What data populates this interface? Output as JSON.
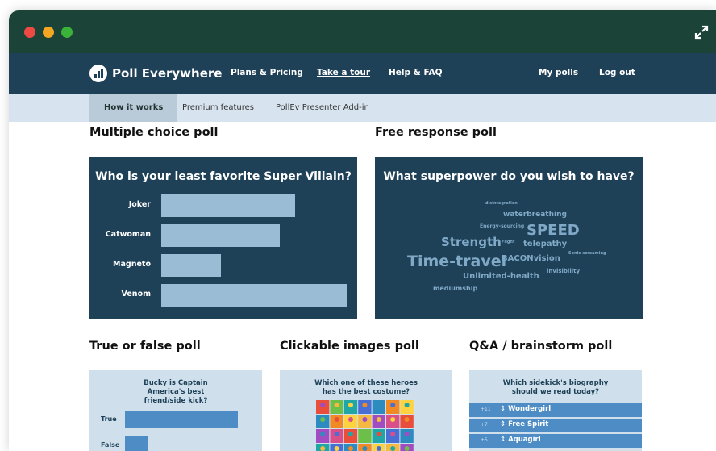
{
  "window": {
    "controls": [
      "close",
      "minimize",
      "maximize"
    ],
    "expand_icon": "expand-arrows-icon"
  },
  "nav": {
    "brand": "Poll Everywhere",
    "links": {
      "plans": "Plans & Pricing",
      "tour": "Take a tour",
      "help": "Help & FAQ",
      "mypolls": "My polls",
      "logout": "Log out"
    }
  },
  "subnav": {
    "tabs": [
      "How it works",
      "Premium features",
      "PollEv Presenter Add-in"
    ],
    "active": "How it works"
  },
  "sections": {
    "multiple_choice": "Multiple choice poll",
    "free_response": "Free response poll",
    "true_false": "True or false poll",
    "clickable_images": "Clickable images poll",
    "qa": "Q&A / brainstorm poll"
  },
  "colors": {
    "navy": "#1f4158",
    "titlebar": "#1b4337",
    "bar": "#9bbcd5",
    "word": "#7fa9c6",
    "card": "#cfe0ec",
    "accent": "#4d8cc5"
  },
  "chart_data": [
    {
      "type": "bar",
      "title": "Who is your least favorite Super Villain?",
      "orientation": "horizontal",
      "categories": [
        "Joker",
        "Catwoman",
        "Magneto",
        "Venom"
      ],
      "values": [
        0.72,
        0.64,
        0.32,
        1.0
      ]
    },
    {
      "type": "bar",
      "title": "Bucky is Captain America's best friend/side kick?",
      "orientation": "horizontal",
      "categories": [
        "True",
        "False"
      ],
      "values": [
        1.0,
        0.2
      ]
    }
  ],
  "wordcloud": {
    "title": "What superpower do you wish to have?",
    "words": [
      {
        "text": "disintegration",
        "size": 5
      },
      {
        "text": "waterbreathing",
        "size": 9
      },
      {
        "text": "Energy-sourcing",
        "size": 6
      },
      {
        "text": "SPEED",
        "size": 18
      },
      {
        "text": "Strength",
        "size": 15
      },
      {
        "text": "Flight",
        "size": 5
      },
      {
        "text": "telepathy",
        "size": 10
      },
      {
        "text": "Time-travel",
        "size": 19
      },
      {
        "text": "BACONvision",
        "size": 10
      },
      {
        "text": "Sonic-screaming",
        "size": 5
      },
      {
        "text": "invisibility",
        "size": 7
      },
      {
        "text": "Unlimited-health",
        "size": 10
      },
      {
        "text": "mediumship",
        "size": 8
      }
    ]
  },
  "clickable": {
    "question": "Which one of these heroes has the best costume?"
  },
  "qa": {
    "question": "Which sidekick's biography should we read today?",
    "items": [
      {
        "votes": "+11",
        "text": "Wondergirl"
      },
      {
        "votes": "+7",
        "text": "Free Spirit"
      },
      {
        "votes": "+5",
        "text": "Aquagirl"
      }
    ]
  }
}
